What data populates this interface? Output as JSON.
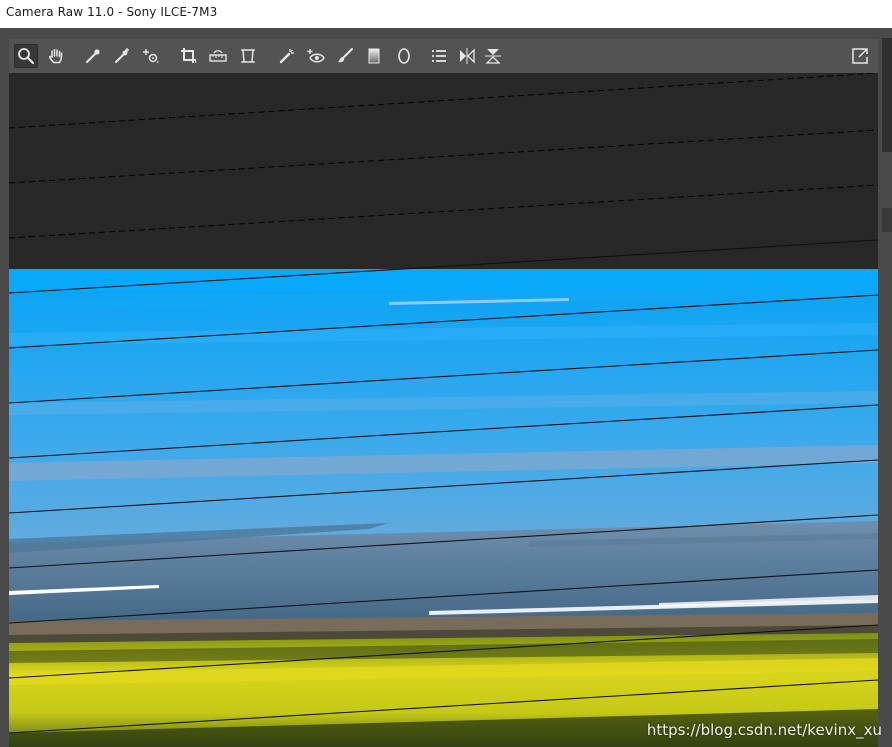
{
  "window": {
    "title": "Camera Raw 11.0 -  Sony ILCE-7M3"
  },
  "toolbar": {
    "tools": [
      {
        "icon": "zoom-icon",
        "active": true
      },
      {
        "icon": "hand-icon",
        "active": false
      },
      {
        "icon": "white-balance-icon",
        "active": false
      },
      {
        "icon": "color-sampler-icon",
        "active": false
      },
      {
        "icon": "targeted-adjustment-icon",
        "active": false
      },
      {
        "icon": "crop-icon",
        "active": false
      },
      {
        "icon": "straighten-icon",
        "active": false
      },
      {
        "icon": "transform-icon",
        "active": false
      },
      {
        "icon": "spot-removal-icon",
        "active": false
      },
      {
        "icon": "red-eye-icon",
        "active": false
      },
      {
        "icon": "adjustment-brush-icon",
        "active": false
      },
      {
        "icon": "graduated-filter-icon",
        "active": false
      },
      {
        "icon": "radial-filter-icon",
        "active": false
      },
      {
        "icon": "preferences-list-icon",
        "active": false
      },
      {
        "icon": "rotate-left-icon",
        "active": false
      },
      {
        "icon": "rotate-right-icon",
        "active": false
      },
      {
        "icon": "toggle-fullscreen-icon",
        "active": false
      }
    ]
  },
  "preview": {
    "colors": {
      "background": "#282828",
      "sky_top": "#0aa2f2",
      "sky_mid": "#6aaee0",
      "haze": "#8aa6c8",
      "sea": "#4f7391",
      "shore": "#7a6a58",
      "field": "#d3d21a",
      "field_shadow": "#4a5a10"
    }
  },
  "watermark": {
    "text": "https://blog.csdn.net/kevinx_xu"
  }
}
